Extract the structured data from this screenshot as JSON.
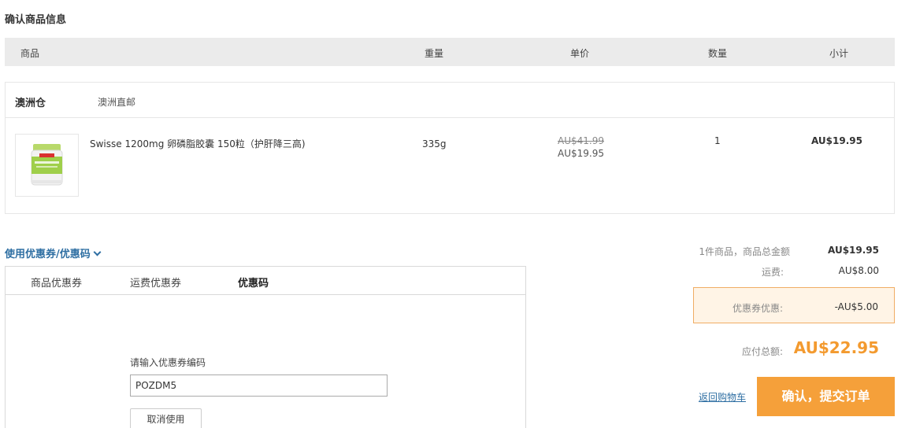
{
  "page": {
    "section_title": "确认商品信息"
  },
  "table": {
    "headers": {
      "product": "商品",
      "weight": "重量",
      "unit_price": "单价",
      "quantity": "数量",
      "subtotal": "小计"
    }
  },
  "warehouse": {
    "name": "澳洲仓",
    "shipping_type": "澳洲直邮",
    "item": {
      "name": "Swisse 1200mg 卵磷脂胶囊 150粒（护肝降三高)",
      "weight": "335g",
      "original_price": "AU$41.99",
      "price": "AU$19.95",
      "quantity": "1",
      "subtotal": "AU$19.95"
    }
  },
  "coupon": {
    "toggle_label": "使用优惠券/优惠码",
    "tabs": [
      "商品优惠券",
      "运费优惠券",
      "优惠码"
    ],
    "active_tab": "优惠码",
    "code_label": "请输入优惠券编码",
    "code_value": "POZDM5",
    "cancel_label": "取消使用"
  },
  "summary": {
    "goods_label": "1件商品，商品总金额",
    "goods_value": "AU$19.95",
    "shipping_label": "运费:",
    "shipping_value": "AU$8.00",
    "discount_label": "优惠券优惠:",
    "discount_value": "-AU$5.00",
    "total_label": "应付总额:",
    "total_value": "AU$22.95"
  },
  "actions": {
    "back_label": "返回购物车",
    "submit_label": "确认，提交订单"
  },
  "colors": {
    "accent_orange": "#f5a03a",
    "total_orange": "#f39a2f",
    "link_blue": "#2f6fa3",
    "discount_bg": "#fff4e6",
    "header_bg": "#ebebeb"
  }
}
